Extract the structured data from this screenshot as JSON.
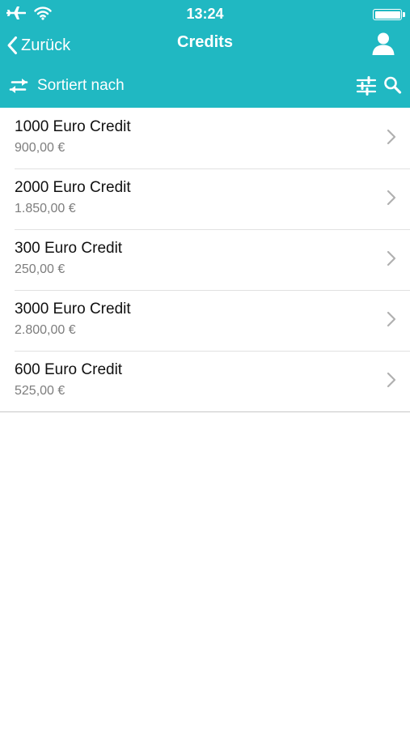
{
  "status_bar": {
    "time": "13:24",
    "icons": [
      "airplane-icon",
      "wifi-icon",
      "battery-icon"
    ]
  },
  "nav": {
    "back_label": "Zurück",
    "title": "Credits",
    "right_icon": "person-icon"
  },
  "toolbar": {
    "sort_label": "Sortiert nach",
    "sort_icon": "swap-arrows-icon",
    "filter_icon": "sliders-icon",
    "search_icon": "search-icon"
  },
  "items": [
    {
      "title": "1000 Euro Credit",
      "price": "900,00 €"
    },
    {
      "title": "2000 Euro Credit",
      "price": "1.850,00 €"
    },
    {
      "title": "300 Euro Credit",
      "price": "250,00 €"
    },
    {
      "title": "3000 Euro Credit",
      "price": "2.800,00 €"
    },
    {
      "title": "600 Euro Credit",
      "price": "525,00 €"
    }
  ],
  "colors": {
    "header": "#20b8c2",
    "header_text": "#ffffff",
    "price_text": "#7d7d7d",
    "chevron": "#b0b0b0"
  }
}
